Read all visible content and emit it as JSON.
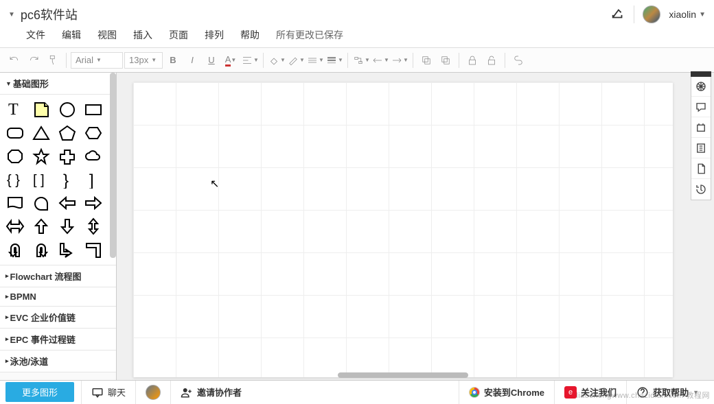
{
  "header": {
    "title": "pc6软件站",
    "username": "xiaolin"
  },
  "menu": {
    "file": "文件",
    "edit": "编辑",
    "view": "视图",
    "insert": "插入",
    "page": "页面",
    "arrange": "排列",
    "help": "帮助",
    "save_status": "所有更改已保存"
  },
  "toolbar": {
    "font": "Arial",
    "size": "13px"
  },
  "sidebar": {
    "basic_shapes": "基础图形",
    "flowchart": "Flowchart 流程图",
    "bpmn": "BPMN",
    "evc": "EVC 企业价值链",
    "epc": "EPC 事件过程链",
    "pool": "泳池/泳道",
    "more_shapes": "更多图形"
  },
  "footer": {
    "chat": "聊天",
    "invite": "邀请协作者",
    "install_chrome": "安装到Chrome",
    "follow": "关注我们",
    "help": "获取帮助"
  },
  "watermark": "liaochengwww.chazidian.com 教程网",
  "icons": {
    "share": "share-icon",
    "undo": "undo-icon",
    "redo": "redo-icon",
    "paint": "format-paint-icon"
  }
}
